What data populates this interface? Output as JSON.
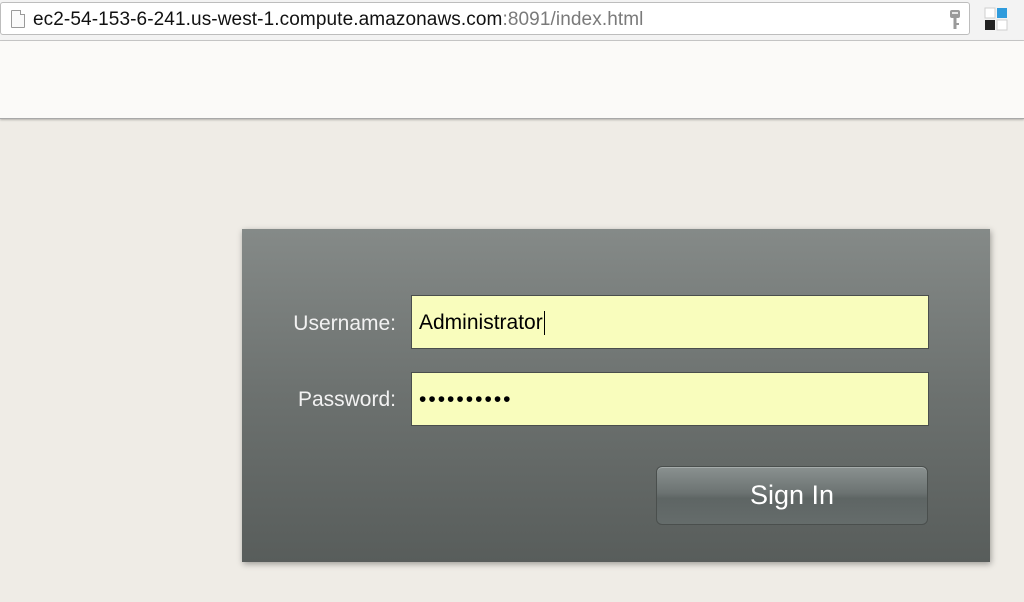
{
  "browser": {
    "url_host": "ec2-54-153-6-241.us-west-1.compute.amazonaws.com",
    "url_rest": ":8091/index.html",
    "icons": [
      "page-icon",
      "key-icon",
      "extension-icon"
    ]
  },
  "login": {
    "username_label": "Username:",
    "username_value": "Administrator",
    "password_label": "Password:",
    "password_value": "••••••••••",
    "signin_label": "Sign In"
  },
  "colors": {
    "field_background": "#f9fdbd",
    "panel_top": "#858a88",
    "panel_bottom": "#585d5b",
    "page_background": "#efece6"
  }
}
